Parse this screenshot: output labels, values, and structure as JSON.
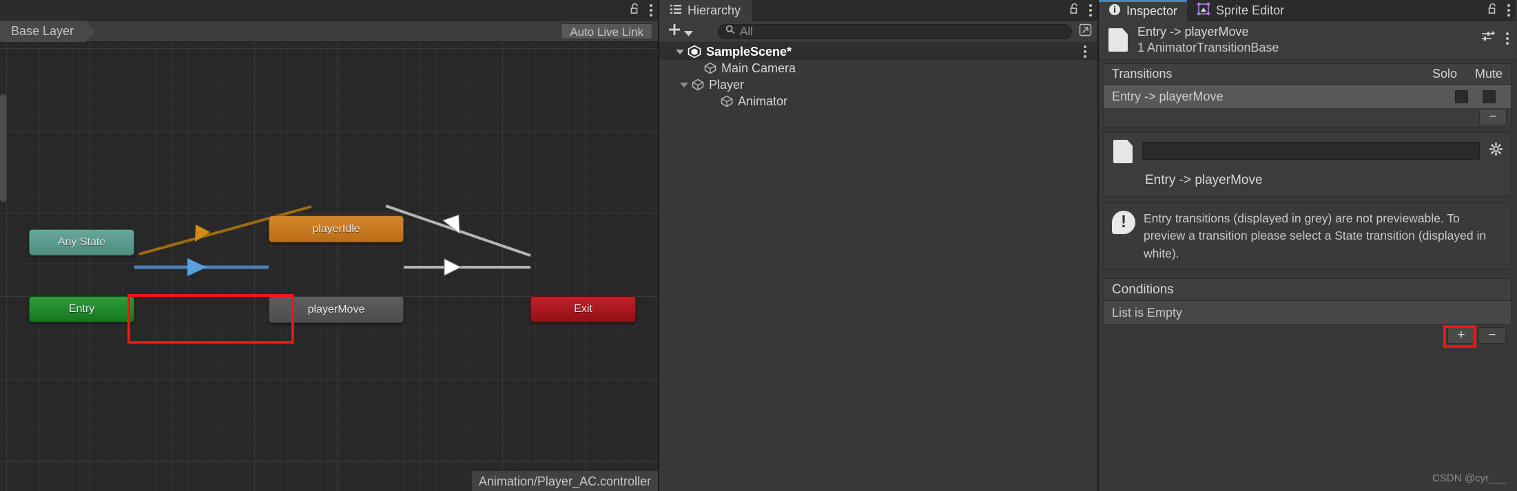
{
  "animator": {
    "breadcrumb": "Base Layer",
    "auto_live_link": "Auto Live Link",
    "controller_path": "Animation/Player_AC.controller",
    "lock_icon": "lock-open-icon",
    "kebab_icon": "kebab-menu-icon",
    "nodes": [
      {
        "id": "any-state",
        "label": "Any State",
        "color": "#4e8d80"
      },
      {
        "id": "entry",
        "label": "Entry",
        "color": "#16761f"
      },
      {
        "id": "player-idle",
        "label": "playerIdle",
        "color": "#b96d18"
      },
      {
        "id": "player-move",
        "label": "playerMove",
        "color": "#4d4d4d"
      },
      {
        "id": "exit",
        "label": "Exit",
        "color": "#921016"
      }
    ],
    "transitions": [
      {
        "from": "entry",
        "to": "player-move",
        "color": "#4a80b8",
        "selected": true
      },
      {
        "from": "player-idle",
        "to": "entry",
        "color": "#a06b0c",
        "selected": false
      },
      {
        "from": "player-idle",
        "to": "exit",
        "color": "#b5b5b5",
        "selected": false
      },
      {
        "from": "player-move",
        "to": "exit",
        "color": "#b5b5b5",
        "selected": false
      }
    ],
    "highlight_color": "#fb1116"
  },
  "hierarchy": {
    "tab_label": "Hierarchy",
    "tab_icon": "hierarchy-icon",
    "add_label": "+",
    "search_placeholder": "All",
    "search_value": "",
    "search_icon": "search-icon",
    "lock_icon": "lock-open-icon",
    "kebab_icon": "kebab-menu-icon",
    "expand_icon": "expand-window-icon",
    "items": [
      {
        "label": "SampleScene*",
        "depth": 0,
        "expanded": true,
        "icon": "unity-scene-icon",
        "is_scene": true
      },
      {
        "label": "Main Camera",
        "depth": 1,
        "expanded": null,
        "icon": "gameobject-cube-icon",
        "is_scene": false
      },
      {
        "label": "Player",
        "depth": 1,
        "expanded": true,
        "icon": "gameobject-cube-icon",
        "is_scene": false
      },
      {
        "label": "Animator",
        "depth": 2,
        "expanded": null,
        "icon": "gameobject-cube-icon",
        "is_scene": false
      }
    ]
  },
  "inspector": {
    "tabs": [
      {
        "label": "Inspector",
        "icon": "info-icon",
        "active": true
      },
      {
        "label": "Sprite Editor",
        "icon": "sprite-editor-icon",
        "active": false
      }
    ],
    "lock_icon": "lock-open-icon",
    "kebab_icon": "kebab-menu-icon",
    "asset": {
      "title": "Entry -> playerMove",
      "subtitle": "1 AnimatorTransitionBase",
      "icon": "document-icon",
      "preset_icon": "preset-sliders-icon",
      "kebab_icon": "kebab-menu-icon"
    },
    "transitions_section": {
      "title": "Transitions",
      "solo_label": "Solo",
      "mute_label": "Mute",
      "rows": [
        {
          "label": "Entry -> playerMove",
          "solo": false,
          "mute": false,
          "selected": true
        }
      ],
      "remove_label": "−"
    },
    "detail": {
      "name_value": "",
      "name_placeholder": "",
      "display_name": "Entry -> playerMove",
      "gear_icon": "gear-icon",
      "doc_icon": "document-icon"
    },
    "info": {
      "icon": "warning-icon",
      "text": "Entry transitions (displayed in grey) are not previewable. To preview a transition please select a State transition (displayed in white)."
    },
    "conditions": {
      "title": "Conditions",
      "empty_text": "List is Empty",
      "add_label": "+",
      "remove_label": "−",
      "highlight_color": "#fb1116"
    },
    "watermark": "CSDN @cyr___"
  }
}
